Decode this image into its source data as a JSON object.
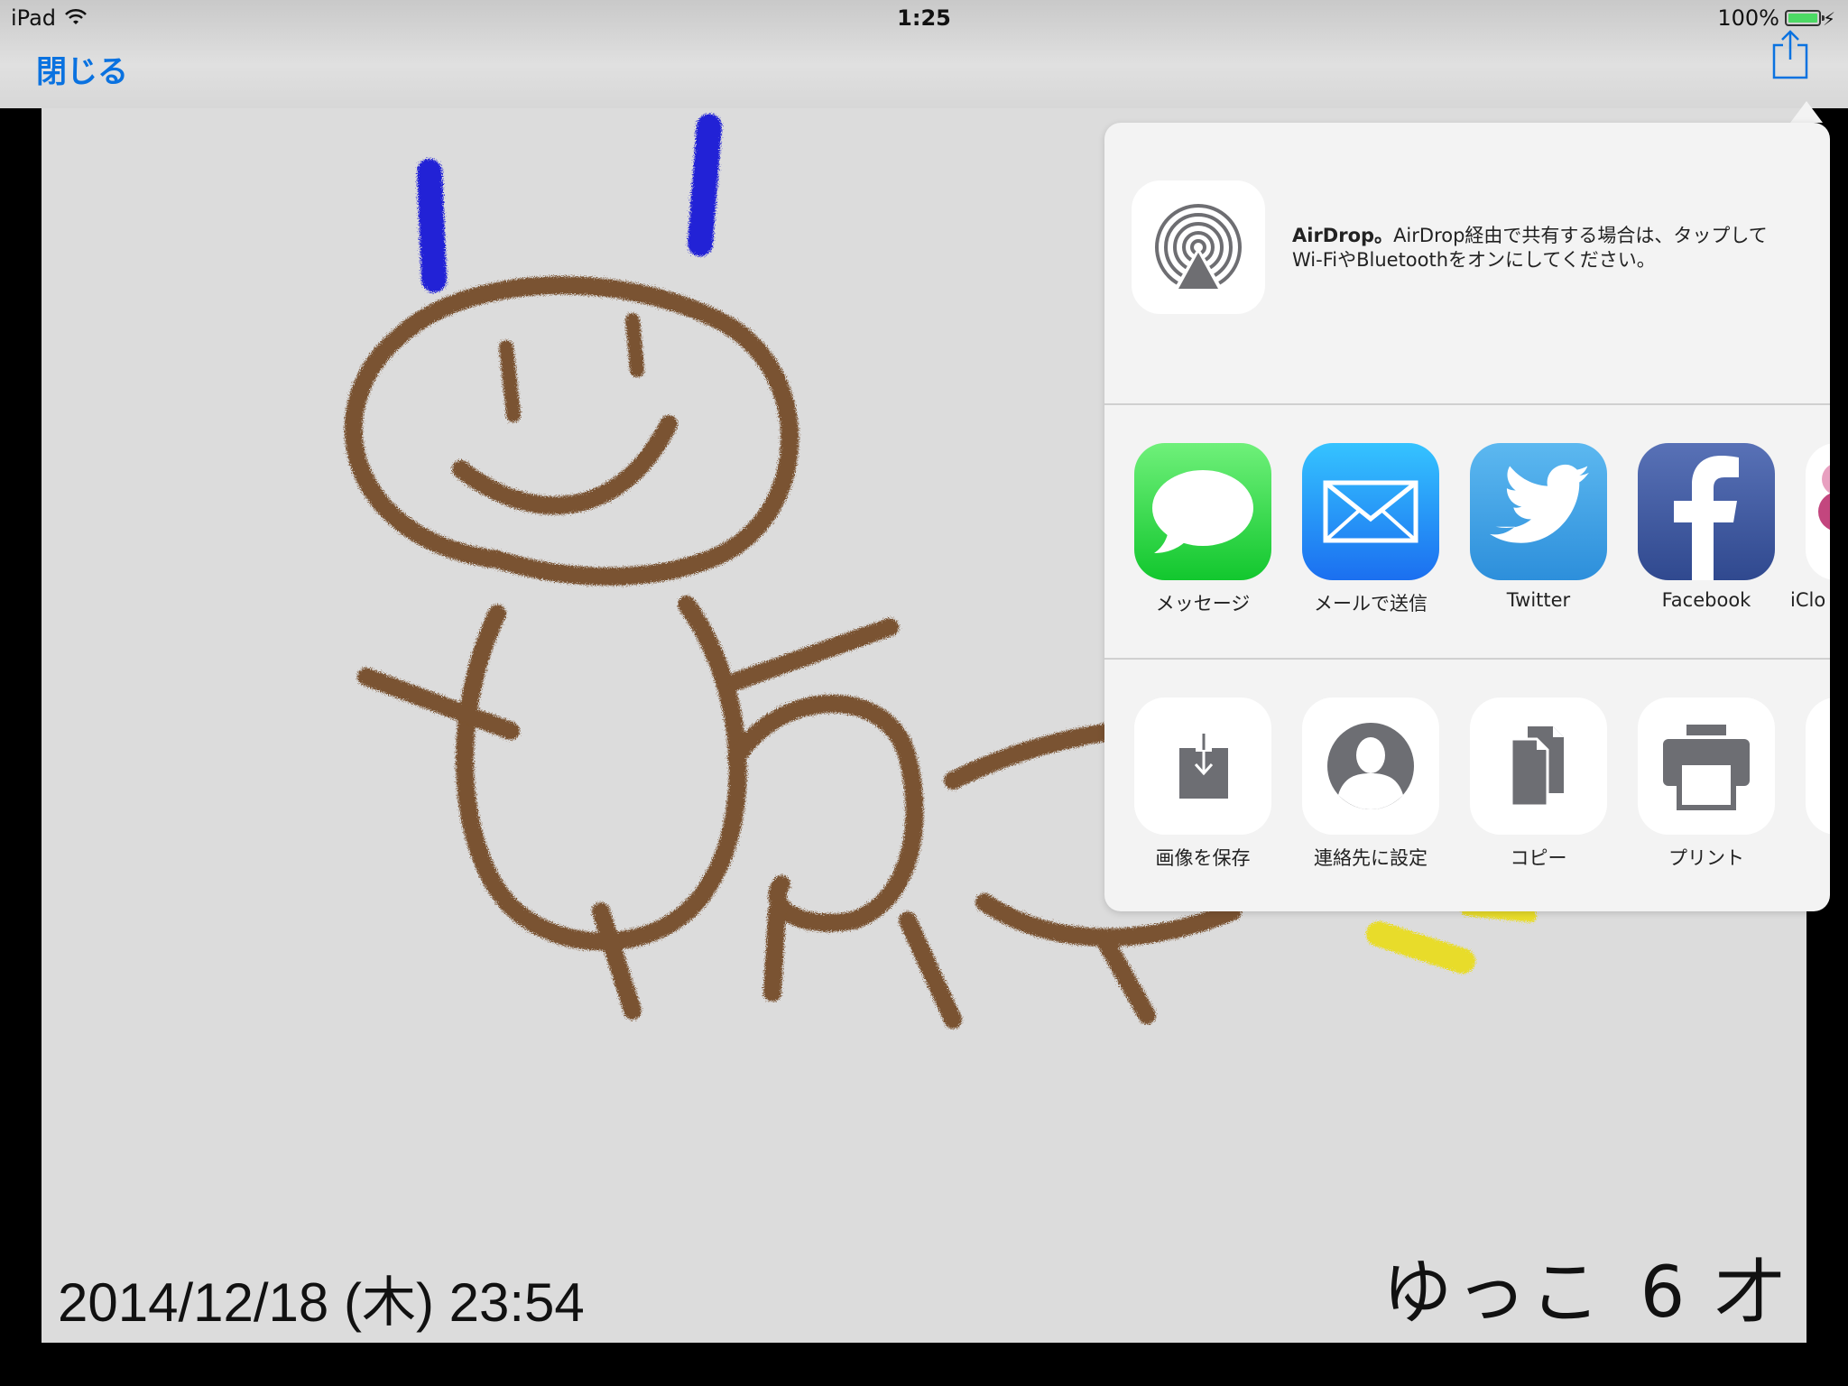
{
  "status_bar": {
    "carrier": "iPad",
    "time": "1:25",
    "battery": "100%"
  },
  "nav": {
    "close_label": "閉じる"
  },
  "canvas": {
    "timestamp": "2014/12/18 (木) 23:54",
    "artist_name": "ゆっこ",
    "artist_age": "6 才"
  },
  "share_sheet": {
    "airdrop_title": "AirDrop。",
    "airdrop_desc": "AirDrop経由で共有する場合は、タップしてWi-FiやBluetoothをオンにしてください。",
    "apps": [
      {
        "label": "メッセージ",
        "icon": "messages-icon"
      },
      {
        "label": "メールで送信",
        "icon": "mail-icon"
      },
      {
        "label": "Twitter",
        "icon": "twitter-icon"
      },
      {
        "label": "Facebook",
        "icon": "facebook-icon"
      },
      {
        "label": "iClo",
        "icon": "icloud-photo-icon"
      }
    ],
    "actions": [
      {
        "label": "画像を保存",
        "icon": "save-image-icon"
      },
      {
        "label": "連絡先に設定",
        "icon": "assign-contact-icon"
      },
      {
        "label": "コピー",
        "icon": "copy-icon"
      },
      {
        "label": "プリント",
        "icon": "print-icon"
      }
    ]
  },
  "colors": {
    "accent": "#0a72e0",
    "crayon_brown": "#7a5330",
    "crayon_blue": "#2323d6",
    "crayon_yellow": "#e8dc2a"
  }
}
